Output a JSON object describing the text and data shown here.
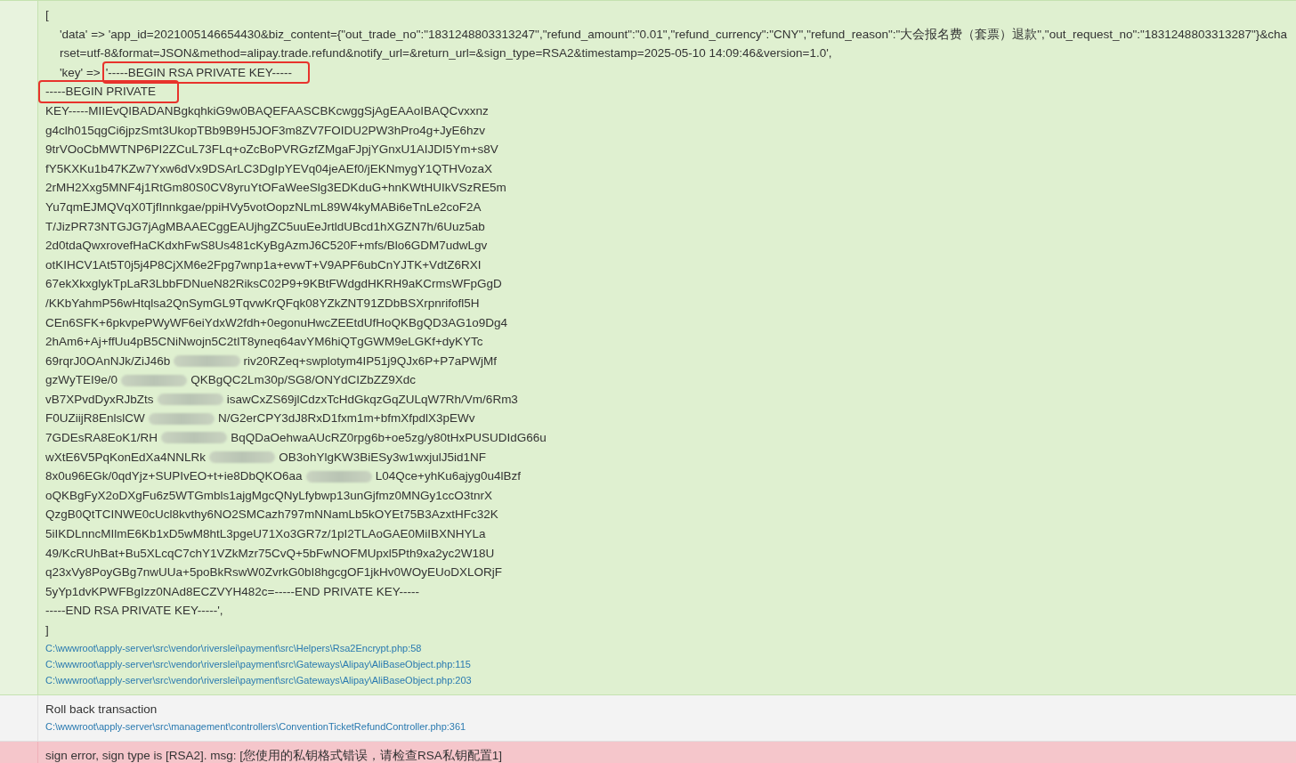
{
  "entries": [
    {
      "kind": "success",
      "lines": [
        {
          "kind": "plain",
          "segments": [
            {
              "text": "[",
              "highlighted": false
            }
          ]
        },
        {
          "kind": "indented",
          "segments": [
            {
              "text": "'data' => 'app_id=2021005146654430&biz_content={\"out_trade_no\":\"1831248803313247\",\"refund_amount\":\"0.01\",\"refund_currency\":\"CNY\",\"refund_reason\":\"大会报名费（套票）退款\",\"out_request_no\":\"1831248803313287\"}&charset=utf-8&format=JSON&method=alipay.trade.refund&notify_url=&return_url=&sign_type=RSA2&timestamp=2025-05-10 14:09:46&version=1.0',",
              "highlighted": false
            }
          ]
        },
        {
          "kind": "indented",
          "segments": [
            {
              "text": "'key' =>",
              "highlighted": false
            },
            {
              "text": "'-----BEGIN RSA PRIVATE KEY-----",
              "highlighted": true
            }
          ]
        },
        {
          "kind": "plain",
          "segments": [
            {
              "text": "-----BEGIN PRIVATE",
              "highlighted": true
            }
          ]
        },
        {
          "kind": "plain",
          "segments": [
            {
              "text": "KEY-----MIIEvQIBADANBgkqhkiG9w0BAQEFAASCBKcwggSjAgEAAoIBAQCvxxnz",
              "highlighted": false
            }
          ]
        },
        {
          "kind": "plain",
          "segments": [
            {
              "text": "g4clh015qgCi6jpzSmt3UkopTBb9B9H5JOF3m8ZV7FOIDU2PW3hPro4g+JyE6hzv",
              "highlighted": false
            }
          ]
        },
        {
          "kind": "plain",
          "segments": [
            {
              "text": "9trVOoCbMWTNP6PI2ZCuL73FLq+oZcBoPVRGzfZMgaFJpjYGnxU1AIJDI5Ym+s8V",
              "highlighted": false
            }
          ]
        },
        {
          "kind": "plain",
          "segments": [
            {
              "text": "fY5KXKu1b47KZw7Yxw6dVx9DSArLC3DgIpYEVq04jeAEf0/jEKNmygY1QTHVozaX",
              "highlighted": false
            }
          ]
        },
        {
          "kind": "plain",
          "segments": [
            {
              "text": "2rMH2Xxg5MNF4j1RtGm80S0CV8yruYtOFaWeeSlg3EDKduG+hnKWtHUIkVSzRE5m",
              "highlighted": false
            }
          ]
        },
        {
          "kind": "plain",
          "segments": [
            {
              "text": "Yu7qmEJMQVqX0TjfInnkgae/ppiHVy5votOopzNLmL89W4kyMABi6eTnLe2coF2A",
              "highlighted": false
            }
          ]
        },
        {
          "kind": "plain",
          "segments": [
            {
              "text": "T/JizPR73NTGJG7jAgMBAAECggEAUjhgZC5uuEeJrtldUBcd1hXGZN7h/6Uuz5ab",
              "highlighted": false
            }
          ]
        },
        {
          "kind": "plain",
          "segments": [
            {
              "text": "2d0tdaQwxrovefHaCKdxhFwS8Us481cKyBgAzmJ6C520F+mfs/Blo6GDM7udwLgv",
              "highlighted": false
            }
          ]
        },
        {
          "kind": "plain",
          "segments": [
            {
              "text": "otKIHCV1At5T0j5j4P8CjXM6e2Fpg7wnp1a+evwT+V9APF6ubCnYJTK+VdtZ6RXI",
              "highlighted": false
            }
          ]
        },
        {
          "kind": "plain",
          "segments": [
            {
              "text": "67ekXkxglykTpLaR3LbbFDNueN82RiksC02P9+9KBtFWdgdHKRH9aKCrmsWFpGgD",
              "highlighted": false
            }
          ]
        },
        {
          "kind": "plain",
          "segments": [
            {
              "text": "/KKbYahmP56wHtqlsa2QnSymGL9TqvwKrQFqk08YZkZNT91ZDbBSXrpnrifofl5H",
              "highlighted": false
            }
          ]
        },
        {
          "kind": "plain",
          "segments": [
            {
              "text": "CEn6SFK+6pkvpePWyWF6eiYdxW2fdh+0egonuHwcZEEtdUfHoQKBgQD3AG1o9Dg4",
              "highlighted": false
            }
          ]
        },
        {
          "kind": "plain",
          "segments": [
            {
              "text": "2hAm6+Aj+ffUu4pB5CNiNwojn5C2tIT8yneq64avYM6hiQTgGWM9eLGKf+dyKYTc",
              "highlighted": false
            }
          ]
        },
        {
          "kind": "redacted",
          "segments": [
            {
              "text": "69rqrJ0OAnNJk/ZiJ46b",
              "highlighted": false
            },
            {
              "text": "riv20RZeq+swplotym4IP51j9QJx6P+P7aPWjMf",
              "highlighted": false
            }
          ]
        },
        {
          "kind": "redacted",
          "segments": [
            {
              "text": "gzWyTEI9e/0",
              "highlighted": false
            },
            {
              "text": "QKBgQC2Lm30p/SG8/ONYdCIZbZZ9Xdc",
              "highlighted": false
            }
          ]
        },
        {
          "kind": "redacted",
          "segments": [
            {
              "text": "vB7XPvdDyxRJbZts",
              "highlighted": false
            },
            {
              "text": "isawCxZS69jlCdzxTcHdGkqzGqZULqW7Rh/Vm/6Rm3",
              "highlighted": false
            }
          ]
        },
        {
          "kind": "redacted",
          "segments": [
            {
              "text": "F0UZiijR8EnlslCW",
              "highlighted": false
            },
            {
              "text": "N/G2erCPY3dJ8RxD1fxm1m+bfmXfpdlX3pEWv",
              "highlighted": false
            }
          ]
        },
        {
          "kind": "redacted",
          "segments": [
            {
              "text": "7GDEsRA8EoK1/RH",
              "highlighted": false
            },
            {
              "text": "BqQDaOehwaAUcRZ0rpg6b+oe5zg/y80tHxPUSUDIdG66u",
              "highlighted": false
            }
          ]
        },
        {
          "kind": "redacted",
          "segments": [
            {
              "text": "wXtE6V5PqKonEdXa4NNLRk",
              "highlighted": false
            },
            {
              "text": "OB3ohYlgKW3BiESy3w1wxjulJ5id1NF",
              "highlighted": false
            }
          ]
        },
        {
          "kind": "redacted",
          "segments": [
            {
              "text": "8x0u96EGk/0qdYjz+SUPIvEO+t+ie8DbQKO6aa",
              "highlighted": false
            },
            {
              "text": "L04Qce+yhKu6ajyg0u4lBzf",
              "highlighted": false
            }
          ]
        },
        {
          "kind": "plain",
          "segments": [
            {
              "text": "oQKBgFyX2oDXgFu6z5WTGmbls1ajgMgcQNyLfybwp13unGjfmz0MNGy1ccO3tnrX",
              "highlighted": false
            }
          ]
        },
        {
          "kind": "plain",
          "segments": [
            {
              "text": "QzgB0QtTCINWE0cUcl8kvthy6NO2SMCazh797mNNamLb5kOYEt75B3AzxtHFc32K",
              "highlighted": false
            }
          ]
        },
        {
          "kind": "plain",
          "segments": [
            {
              "text": "5iIKDLnncMIlmE6Kb1xD5wM8htL3pgeU71Xo3GR7z/1pI2TLAoGAE0MiIBXNHYLa",
              "highlighted": false
            }
          ]
        },
        {
          "kind": "plain",
          "segments": [
            {
              "text": "49/KcRUhBat+Bu5XLcqC7chY1VZkMzr75CvQ+5bFwNOFMUpxl5Pth9xa2yc2W18U",
              "highlighted": false
            }
          ]
        },
        {
          "kind": "plain",
          "segments": [
            {
              "text": "q23xVy8PoyGBg7nwUUa+5poBkRswW0ZvrkG0bI8hgcgOF1jkHv0WOyEUoDXLORjF",
              "highlighted": false
            }
          ]
        },
        {
          "kind": "plain",
          "segments": [
            {
              "text": "5yYp1dvKPWFBgIzz0NAd8ECZVYH482c=-----END PRIVATE KEY-----",
              "highlighted": false
            }
          ]
        },
        {
          "kind": "plain",
          "segments": [
            {
              "text": "-----END RSA PRIVATE KEY-----',",
              "highlighted": false
            }
          ]
        },
        {
          "kind": "plain",
          "segments": [
            {
              "text": "]",
              "highlighted": false
            }
          ]
        }
      ],
      "trace": [
        "C:\\wwwroot\\apply-server\\src\\vendor\\riverslei\\payment\\src\\Helpers\\Rsa2Encrypt.php:58",
        "C:\\wwwroot\\apply-server\\src\\vendor\\riverslei\\payment\\src\\Gateways\\Alipay\\AliBaseObject.php:115",
        "C:\\wwwroot\\apply-server\\src\\vendor\\riverslei\\payment\\src\\Gateways\\Alipay\\AliBaseObject.php:203"
      ]
    },
    {
      "kind": "info",
      "lines": [
        {
          "kind": "plain",
          "segments": [
            {
              "text": "Roll back transaction",
              "highlighted": false
            }
          ]
        }
      ],
      "trace": [
        "C:\\wwwroot\\apply-server\\src\\management\\controllers\\ConventionTicketRefundController.php:361"
      ]
    },
    {
      "kind": "error",
      "lines": [
        {
          "kind": "plain",
          "segments": [
            {
              "text": "sign error, sign type is [RSA2]. msg: [您使用的私钥格式错误，请检查RSA私钥配置1]",
              "highlighted": false
            }
          ]
        }
      ]
    }
  ]
}
